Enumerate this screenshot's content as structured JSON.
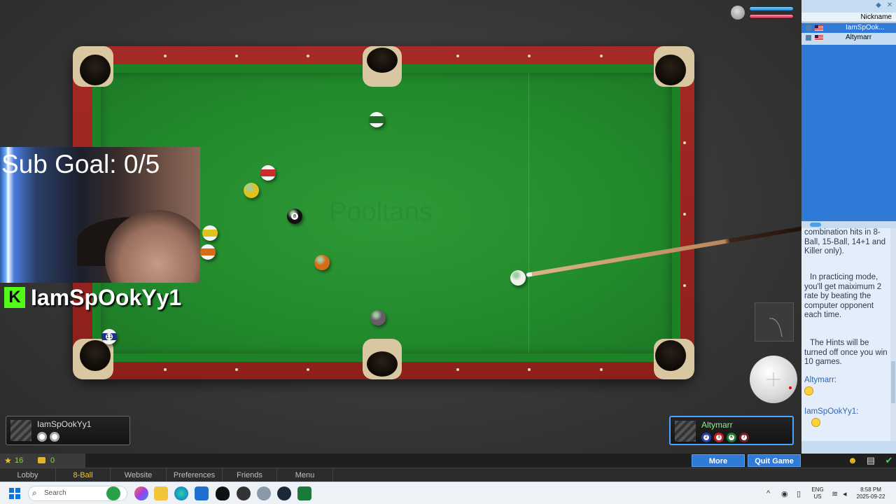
{
  "webcam": {
    "sub_goal": "Sub Goal: 0/5",
    "streamer": "IamSpOokYy1",
    "kick_logo": "K"
  },
  "table": {
    "watermark": "Pooltans"
  },
  "balls": [
    {
      "label": "",
      "color": "#1f6b2a",
      "stripe": true
    },
    {
      "label": "",
      "color": "#cc2b2b",
      "stripe": true
    },
    {
      "label": "",
      "color": "#e0c21e",
      "stripe": false
    },
    {
      "label": "8",
      "color": "#111111",
      "stripe": false
    },
    {
      "label": "",
      "color": "#e0c21e",
      "stripe": true
    },
    {
      "label": "",
      "color": "#d86a1a",
      "stripe": true
    },
    {
      "label": "",
      "color": "#d86a1a",
      "stripe": false
    },
    {
      "label": "",
      "color": "#6a5a6a",
      "stripe": false
    },
    {
      "label": "11",
      "color": "#1c2f8a",
      "stripe": true
    },
    {
      "label": "",
      "color": "#f2f2ec",
      "stripe": false
    }
  ],
  "players": {
    "left": {
      "name": "IamSpOokYy1",
      "balls": [
        {
          "label": "",
          "color": "#aaaaaa"
        },
        {
          "label": "",
          "color": "#aaaaaa"
        }
      ]
    },
    "right": {
      "name": "Altymarr",
      "balls": [
        {
          "label": "2",
          "color": "#1f3fb0"
        },
        {
          "label": "3",
          "color": "#c41f1f"
        },
        {
          "label": "6",
          "color": "#1f7a2a"
        },
        {
          "label": "7",
          "color": "#7a1f1f"
        }
      ]
    }
  },
  "side_panel": {
    "nickname_header": "Nickname",
    "users": [
      "IamSpOok...",
      "Altymarr"
    ],
    "chat": {
      "line1": "combination hits in 8-Ball, 15-Ball, 14+1 and Killer only).",
      "line2": "In practicing mode, you'll get maiximum 2 rate by beating the computer opponent each time.",
      "line3": "The Hints will be turned off once you win 10 games.",
      "msg1_user": "Altymarr:",
      "msg2_user": "IamSpOokYy1:"
    }
  },
  "status": {
    "stars": "16",
    "coins": "0",
    "more": "More",
    "quit": "Quit Game"
  },
  "menu": {
    "lobby": "Lobby",
    "eightball": "8-Ball",
    "website": "Website",
    "preferences": "Preferences",
    "friends": "Friends",
    "menu": "Menu"
  },
  "taskbar": {
    "search_placeholder": "Search",
    "lang": "ENG",
    "region": "US",
    "time": "8:58 PM",
    "date": "2025-09-22"
  },
  "icons": {
    "clock": "clock-icon",
    "smiley": "smiley-icon",
    "chat": "chat-icon",
    "check": "check-icon"
  }
}
